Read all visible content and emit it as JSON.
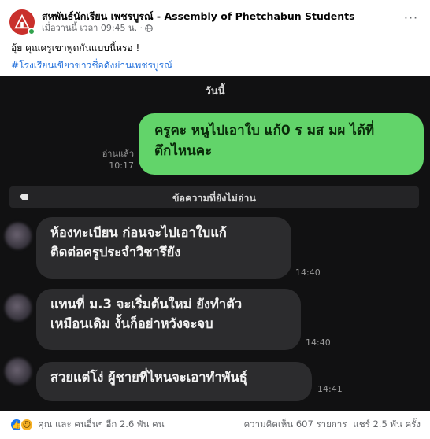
{
  "header": {
    "page_name": "สหพันธ์นักเรียน เพชรบูรณ์ - Assembly of Phetchabun Students",
    "timestamp": "เมื่อวานนี้ เวลา 09:45 น. ·",
    "more": "···"
  },
  "post": {
    "text": "อุ้ย คุณครูเขาพูดกันแบบนี้หรอ !",
    "hashtag": "#โรงเรียนเขียวขาวชื่อดังย่านเพชรบูรณ์"
  },
  "chat": {
    "day_label": "วันนี้",
    "sent": {
      "line1": "ครูคะ หนูไปเอาใบ แก้0 ร มส มผ ได้ที่",
      "line2": "ตึกไหนคะ",
      "status": "อ่านแล้ว",
      "time": "10:17"
    },
    "unread_divider": "ข้อความที่ยังไม่อ่าน",
    "received": [
      {
        "line1": "ห้องทะเบียน ก่อนจะไปเอาใบแก้",
        "line2": "ติดต่อครูประจำวิชารึยัง",
        "time": "14:40"
      },
      {
        "line1": "แทนที่ ม.3 จะเริ่มต้นใหม่ ยังทำตัว",
        "line2": "เหมือนเดิม งั้นก็อย่าหวังจะจบ",
        "time": "14:40"
      },
      {
        "line1": "สวยแต่โง่ ผู้ชายที่ไหนจะเอาทำพันธุ์",
        "time": "14:41"
      }
    ]
  },
  "footer": {
    "reactions_text": "คุณ และ คนอื่นๆ อีก 2.6 พัน คน",
    "comments": "ความคิดเห็น 607 รายการ",
    "shares": "แชร์ 2.5 พัน ครั้ง"
  },
  "colors": {
    "bubble_green": "#62d46a",
    "chat_bg": "#111112",
    "bubble_gray": "#2c2c2e",
    "hashtag": "#216fdb",
    "like": "#1877f2"
  },
  "icons": [
    "page-logo-icon",
    "globe-icon",
    "more-icon",
    "unread-tag-icon",
    "like-icon",
    "haha-icon"
  ]
}
